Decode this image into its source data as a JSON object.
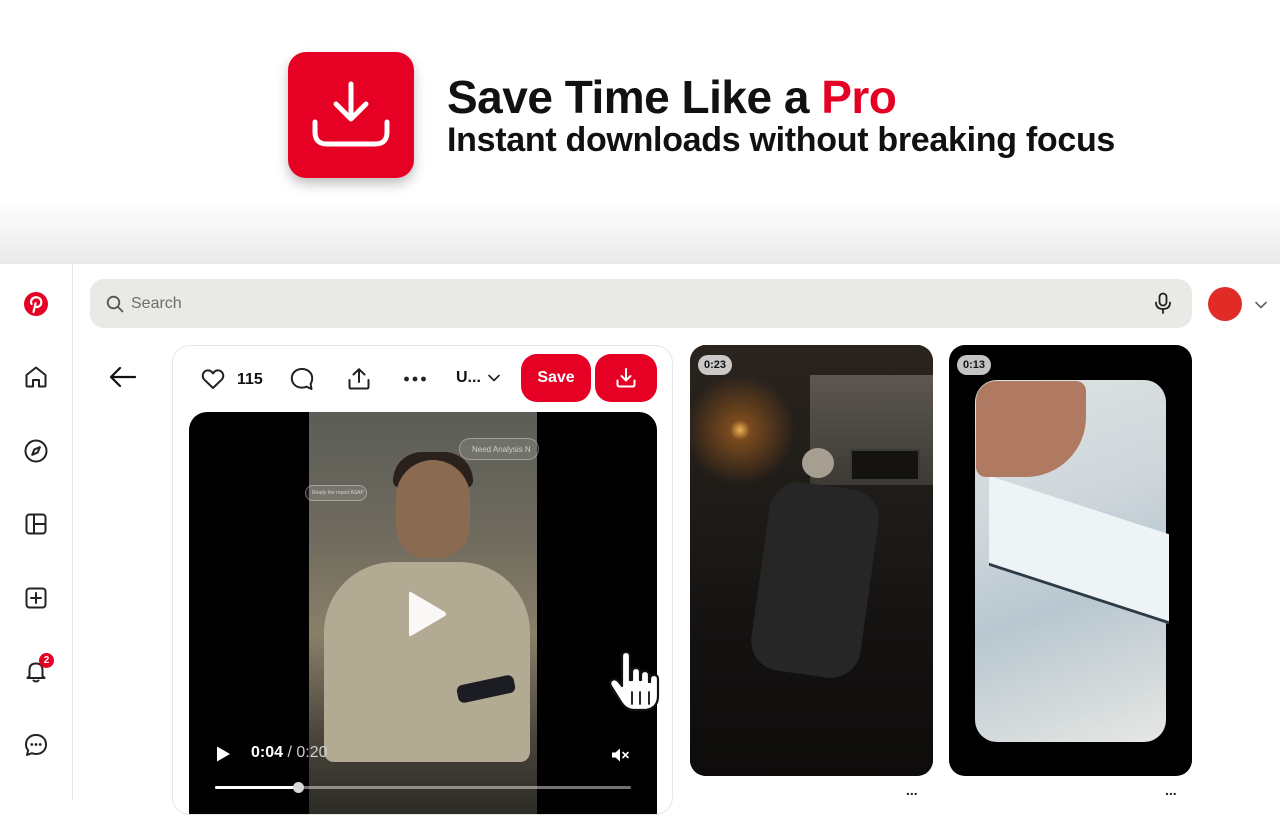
{
  "promo": {
    "headline_main": "Save Time Like a ",
    "headline_accent": "Pro",
    "subline": "Instant downloads without breaking focus",
    "accent_color": "#e60023",
    "app_icon": "download-tray-icon"
  },
  "sidebar": {
    "items": [
      {
        "icon": "pinterest-logo"
      },
      {
        "icon": "home-icon"
      },
      {
        "icon": "explore-compass-icon"
      },
      {
        "icon": "boards-layout-icon"
      },
      {
        "icon": "create-plus-icon"
      },
      {
        "icon": "notifications-bell-icon",
        "badge": "2"
      },
      {
        "icon": "messages-icon"
      }
    ]
  },
  "search": {
    "placeholder": "Search",
    "value": ""
  },
  "pin": {
    "like_count": "115",
    "board_label": "U...",
    "save_label": "Save",
    "video": {
      "current_time": "0:04",
      "separator": " / ",
      "duration": "0:20",
      "progress_fraction": 0.2,
      "bubble_top": "Need Analysis N",
      "bubble_side": "Ready the report ASAP"
    }
  },
  "related": [
    {
      "duration": "0:23"
    },
    {
      "duration": "0:13"
    }
  ],
  "more_label": "..."
}
